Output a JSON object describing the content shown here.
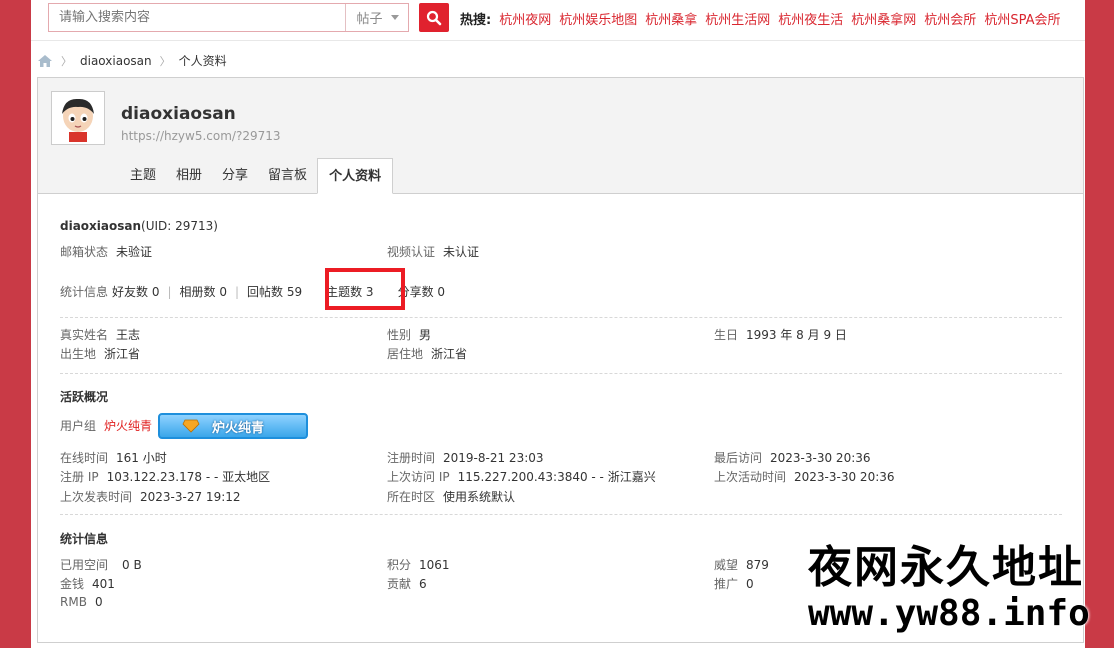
{
  "search": {
    "placeholder": "请输入搜索内容",
    "select_value": "帖子"
  },
  "hot": {
    "label": "热搜:",
    "items": [
      "杭州夜网",
      "杭州娱乐地图",
      "杭州桑拿",
      "杭州生活网",
      "杭州夜生活",
      "杭州桑拿网",
      "杭州会所",
      "杭州SPA会所"
    ]
  },
  "breadcrumb": {
    "user": "diaoxiaosan",
    "page": "个人资料"
  },
  "profile": {
    "name": "diaoxiaosan",
    "url": "https://hzyw5.com/?29713"
  },
  "tabs": [
    "主题",
    "相册",
    "分享",
    "留言板",
    "个人资料"
  ],
  "basic": {
    "name_uid": "diaoxiaosan",
    "uid_text": "(UID: 29713)",
    "email_label": "邮箱状态",
    "email_value": "未验证",
    "video_label": "视频认证",
    "video_value": "未认证"
  },
  "stats": {
    "label": "统计信息",
    "friends": "好友数 0",
    "albums": "相册数 0",
    "replies": "回帖数 59",
    "topics": "主题数 3",
    "shares": "分享数 0"
  },
  "personal": {
    "realname_label": "真实姓名",
    "realname": "王志",
    "gender_label": "性别",
    "gender": "男",
    "birthday_label": "生日",
    "birthday": "1993 年 8 月 9 日",
    "birthplace_label": "出生地",
    "birthplace": "浙江省",
    "residence_label": "居住地",
    "residence": "浙江省"
  },
  "activity": {
    "title": "活跃概况",
    "group_label": "用户组",
    "group_name": "炉火纯青",
    "badge_text": "炉火纯青",
    "online_label": "在线时间",
    "online": "161 小时",
    "reg_time_label": "注册时间",
    "reg_time": "2019-8-21 23:03",
    "last_visit_label": "最后访问",
    "last_visit": "2023-3-30 20:36",
    "reg_ip_label": "注册 IP",
    "reg_ip": "103.122.23.178 - - 亚太地区",
    "last_ip_label": "上次访问 IP",
    "last_ip": "115.227.200.43:3840 - - 浙江嘉兴",
    "last_active_label": "上次活动时间",
    "last_active": "2023-3-30 20:36",
    "last_post_label": "上次发表时间",
    "last_post": "2023-3-27 19:12",
    "tz_label": "所在时区",
    "tz": "使用系统默认"
  },
  "statsinfo": {
    "title": "统计信息",
    "space_label": "已用空间",
    "space": "0 B",
    "points_label": "积分",
    "points": "1061",
    "prestige_label": "威望",
    "prestige": "879",
    "money_label": "金钱",
    "money": "401",
    "contrib_label": "贡献",
    "contrib": "6",
    "promo_label": "推广",
    "promo": "0",
    "rmb_label": "RMB",
    "rmb": "0"
  },
  "watermark": {
    "line1": "夜网永久地址",
    "line2": "www.yw88.info"
  },
  "colors": {
    "accent": "#e0222e",
    "frame": "#c93a46",
    "hot_link": "#d9262f",
    "highlight": "#ec1c24"
  }
}
